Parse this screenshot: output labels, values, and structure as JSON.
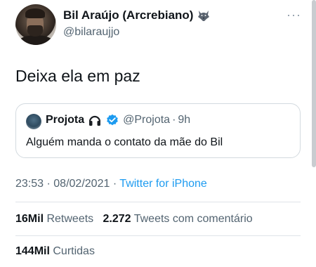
{
  "author": {
    "display_name": "Bil Araújo (Arcrebiano)",
    "handle": "@bilaraujjo",
    "emoji_icon": "wolf-icon"
  },
  "tweet": {
    "text": "Deixa ela em paz"
  },
  "quoted_tweet": {
    "display_name": "Projota",
    "emoji_icon": "headphones-icon",
    "verified": true,
    "handle": "@Projota",
    "separator": "·",
    "time": "9h",
    "text": "Alguém manda o contato da mãe do Bil"
  },
  "meta": {
    "time": "23:53",
    "separator1": "·",
    "date": "08/02/2021",
    "separator2": "·",
    "source": "Twitter for iPhone"
  },
  "stats": {
    "retweets_count": "16Mil",
    "retweets_label": "Retweets",
    "quote_count": "2.272",
    "quote_label": "Tweets com comentário",
    "likes_count": "144Mil",
    "likes_label": "Curtidas"
  },
  "colors": {
    "link": "#1d9bf0",
    "secondary_text": "#536471",
    "verified": "#1d9bf0"
  }
}
